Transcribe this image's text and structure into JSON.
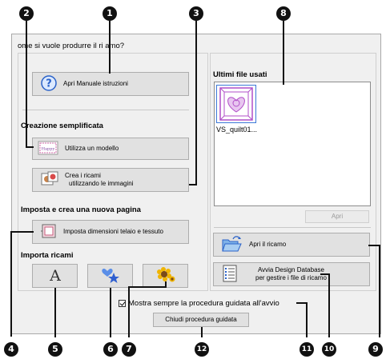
{
  "dialog": {
    "title": "ome si vuole produrre il ri    amo?",
    "help_button": "Apri Manuale istruzioni",
    "section_easy": "Creazione semplificata",
    "template_button": "Utilizza un modello",
    "images_button_line1": "Crea i ricami",
    "images_button_line2": "utilizzando le immagini",
    "section_new_page": "Imposta e crea una nuova pagina",
    "hoop_button": "Imposta dimensioni telaio e tessuto",
    "section_import": "Importa ricami",
    "recent_title": "Ultimi file usati",
    "recent_file": "VS_quilt01...",
    "open_recent_button": "Apri",
    "open_embroidery_button": "Apri il ricamo",
    "design_db_line1": "Avvia Design Database",
    "design_db_line2": "per gestire i file di ricamo",
    "show_checkbox_label": "Mostra sempre la procedura guidata all'avvio",
    "close_button": "Chiudi procedura guidata"
  },
  "callouts": {
    "c1": "1",
    "c2": "2",
    "c3": "3",
    "c4": "4",
    "c5": "5",
    "c6": "6",
    "c7": "7",
    "c8": "8",
    "c9": "9",
    "c10": "10",
    "c11": "11",
    "c12": "12"
  },
  "icons": {
    "help": "question-circle-icon",
    "template": "template-card-icon",
    "images": "photo-icon",
    "hoop": "hoop-frame-icon",
    "font": "letter-a-icon",
    "decorative": "heart-star-icon",
    "clipart": "sunflower-icon",
    "open": "folder-open-icon",
    "database": "list-document-icon"
  },
  "colors": {
    "callout_bg": "#111111",
    "selection": "#3c78d8",
    "quilt_purple": "#b04fc8"
  }
}
